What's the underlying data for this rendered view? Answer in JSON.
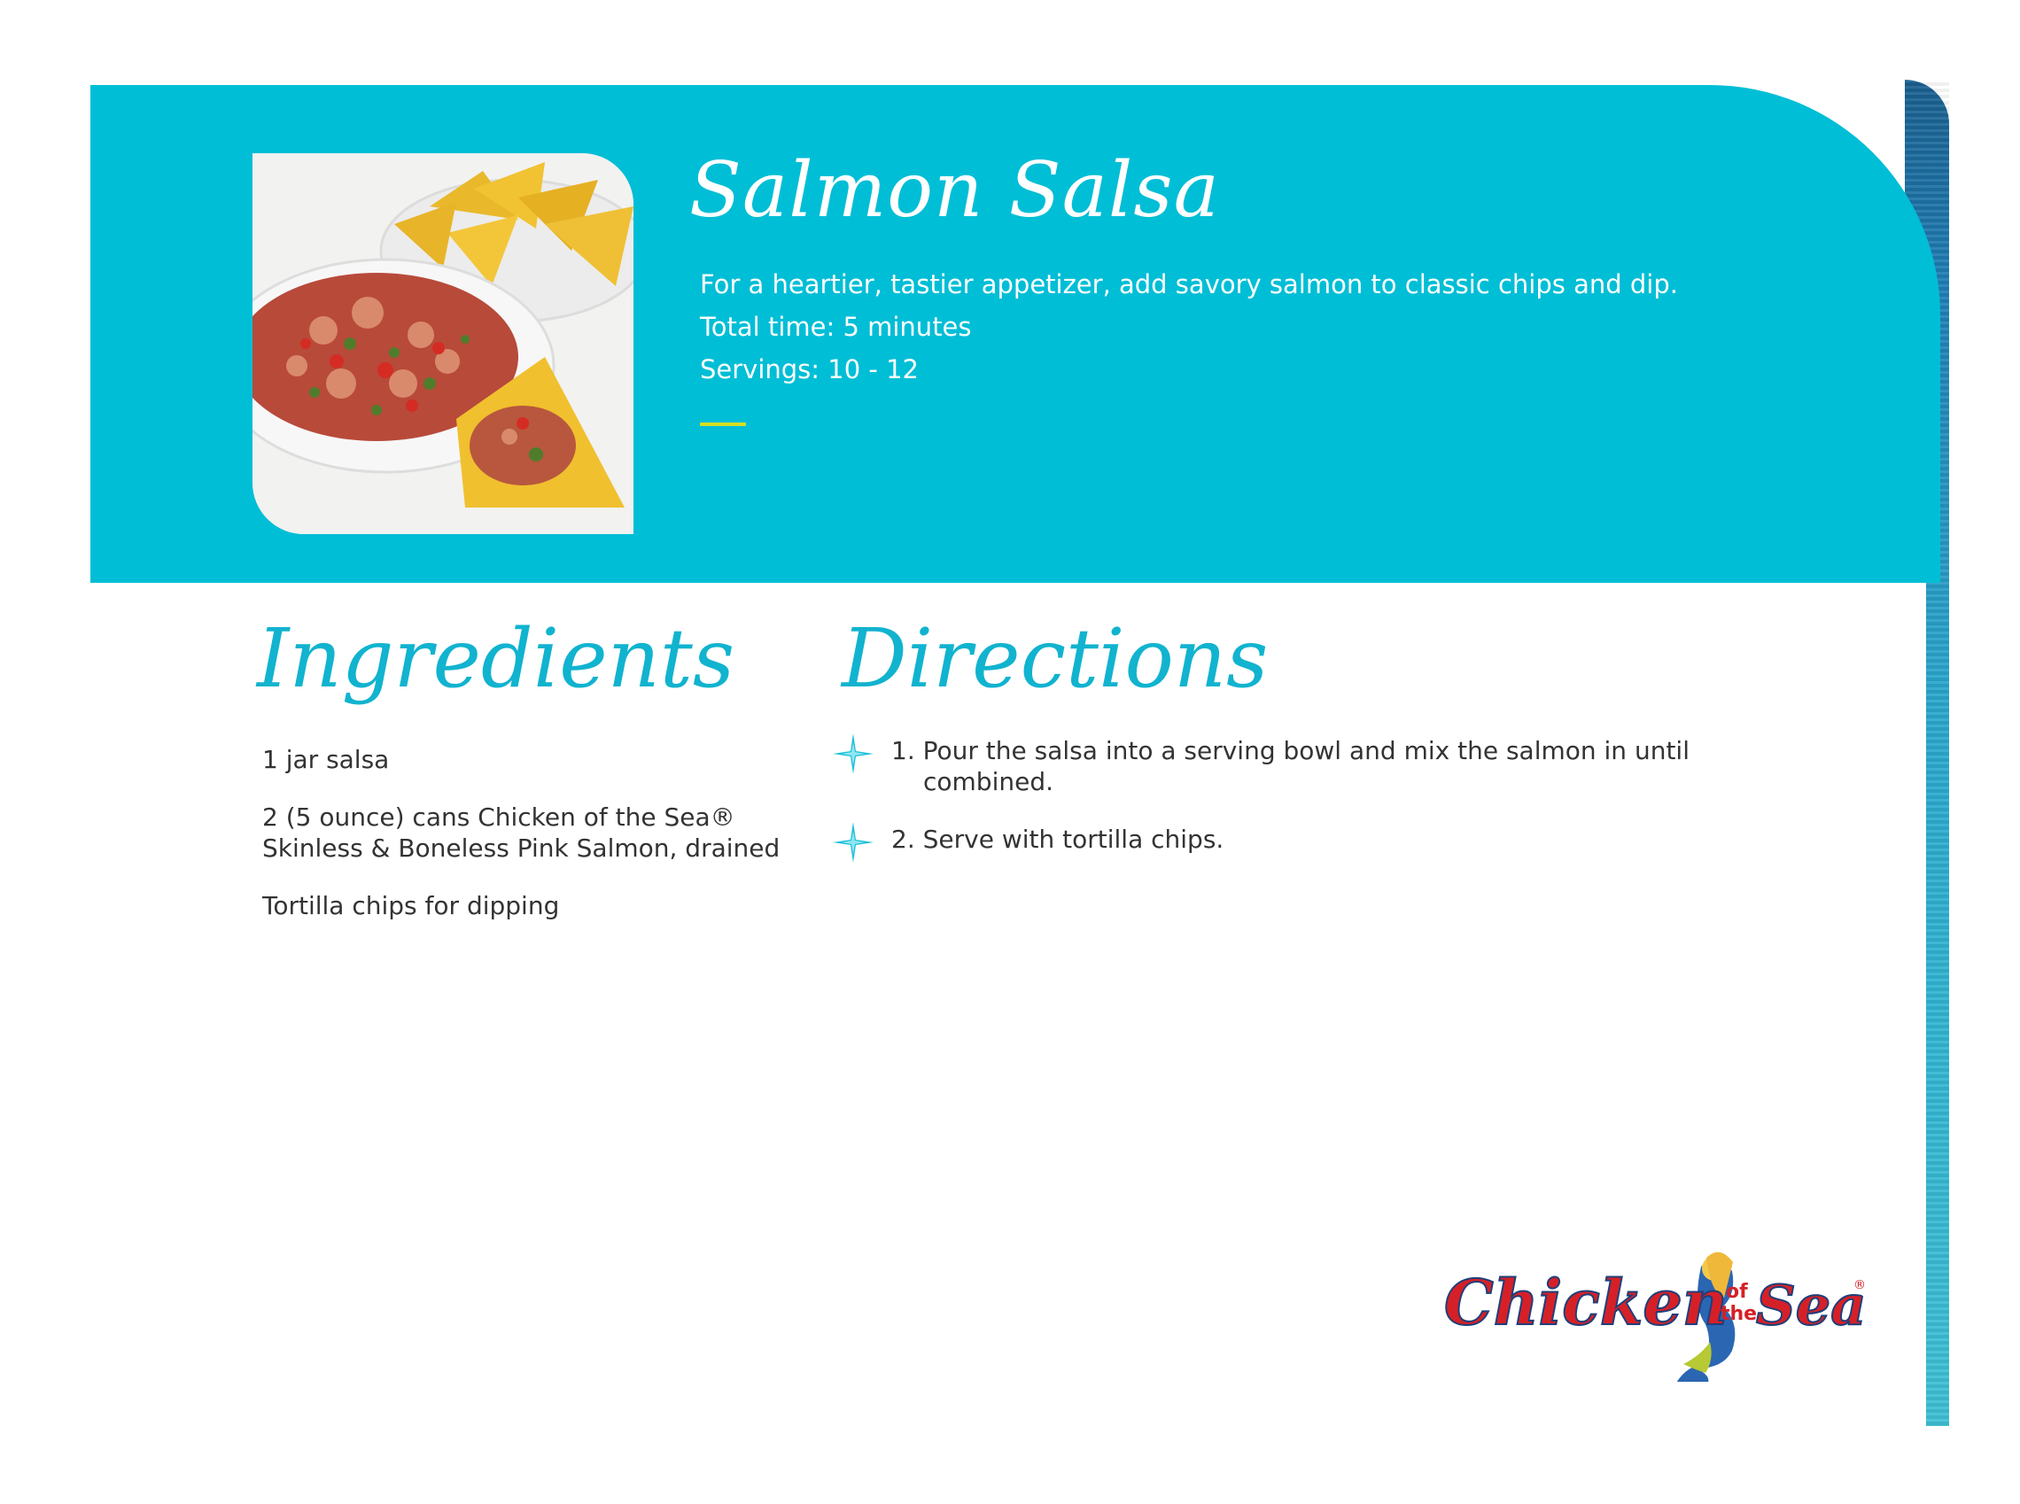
{
  "recipe": {
    "title": "Salmon Salsa",
    "description": "For a heartier, tastier appetizer, add savory salmon to classic chips and dip.",
    "total_time": "Total time: 5 minutes",
    "servings": "Servings: 10 - 12"
  },
  "ingredients": {
    "heading": "Ingredients",
    "items": [
      "1 jar salsa",
      "2 (5 ounce) cans Chicken of the Sea® Skinless & Boneless Pink Salmon, drained",
      "Tortilla chips for dipping"
    ]
  },
  "directions": {
    "heading": "Directions",
    "steps": [
      "1. Pour the salsa into a serving bowl and mix the salmon in until",
      "combined.",
      "2. Serve with tortilla chips."
    ]
  },
  "logo": {
    "word1": "Chicken",
    "word2": "of",
    "word3": "the",
    "word4": "Sea",
    "mark": "®"
  },
  "colors": {
    "banner": "#00bed6",
    "heading": "#11b3cf",
    "accent": "#d6de23",
    "logo_red": "#d62027"
  },
  "icons": [
    "sparkle-bullet-icon",
    "mermaid-logo-icon"
  ]
}
